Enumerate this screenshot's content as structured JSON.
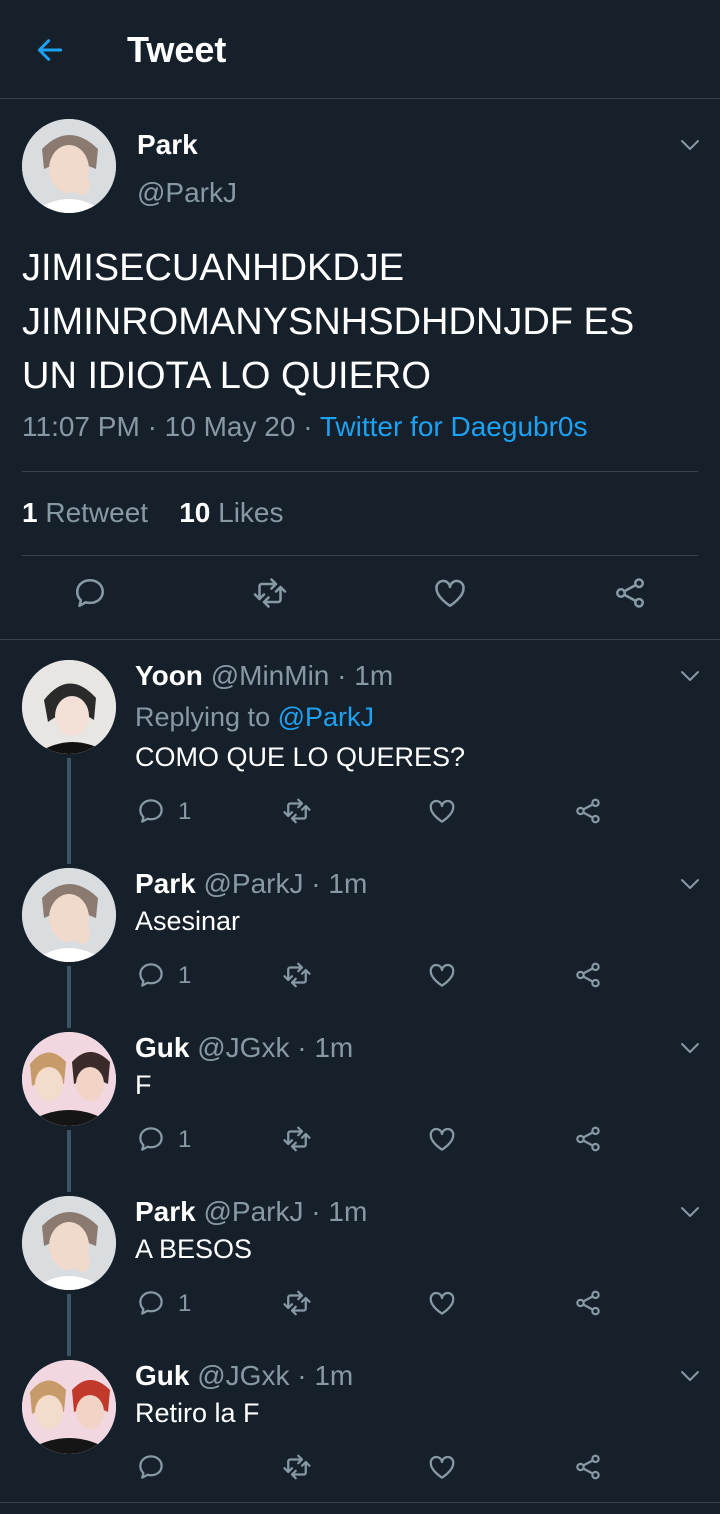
{
  "header": {
    "title": "Tweet",
    "back_icon": "arrow-left-icon",
    "accent": "#1da1f2"
  },
  "main_tweet": {
    "name": "Park",
    "handle": "@ParkJ",
    "text_lines": [
      "JIMISECUANHDKDJE",
      "JIMINROMANYSNHSDHDNJDF ES",
      "UN IDIOTA LO QUIERO"
    ],
    "time": "11:07 PM",
    "sep": "·",
    "date": "10 May 20",
    "source": "Twitter for Daegubr0s",
    "retweets_count": "1",
    "retweets_label": "Retweet",
    "likes_count": "10",
    "likes_label": "Likes"
  },
  "replies": [
    {
      "name": "Yoon",
      "handle": "@MinMin",
      "time": "1m",
      "replying_label": "Replying to",
      "replying_to": "@ParkJ",
      "text": "COMO QUE LO QUERES?",
      "reply_count": "1"
    },
    {
      "name": "Park",
      "handle": "@ParkJ",
      "time": "1m",
      "text": "Asesinar",
      "reply_count": "1"
    },
    {
      "name": "Guk",
      "handle": "@JGxk",
      "time": "1m",
      "text": "F",
      "reply_count": "1"
    },
    {
      "name": "Park",
      "handle": "@ParkJ",
      "time": "1m",
      "text": "A BESOS",
      "reply_count": "1"
    },
    {
      "name": "Guk",
      "handle": "@JGxk",
      "time": "1m",
      "text": "Retiro la F",
      "reply_count": ""
    }
  ],
  "icons": [
    "reply-icon",
    "retweet-icon",
    "like-icon",
    "share-icon",
    "chevron-down-icon"
  ],
  "colors": {
    "background": "#15202b",
    "secondary_text": "#8899a6",
    "link": "#1da1f2",
    "divider": "#38444d"
  }
}
